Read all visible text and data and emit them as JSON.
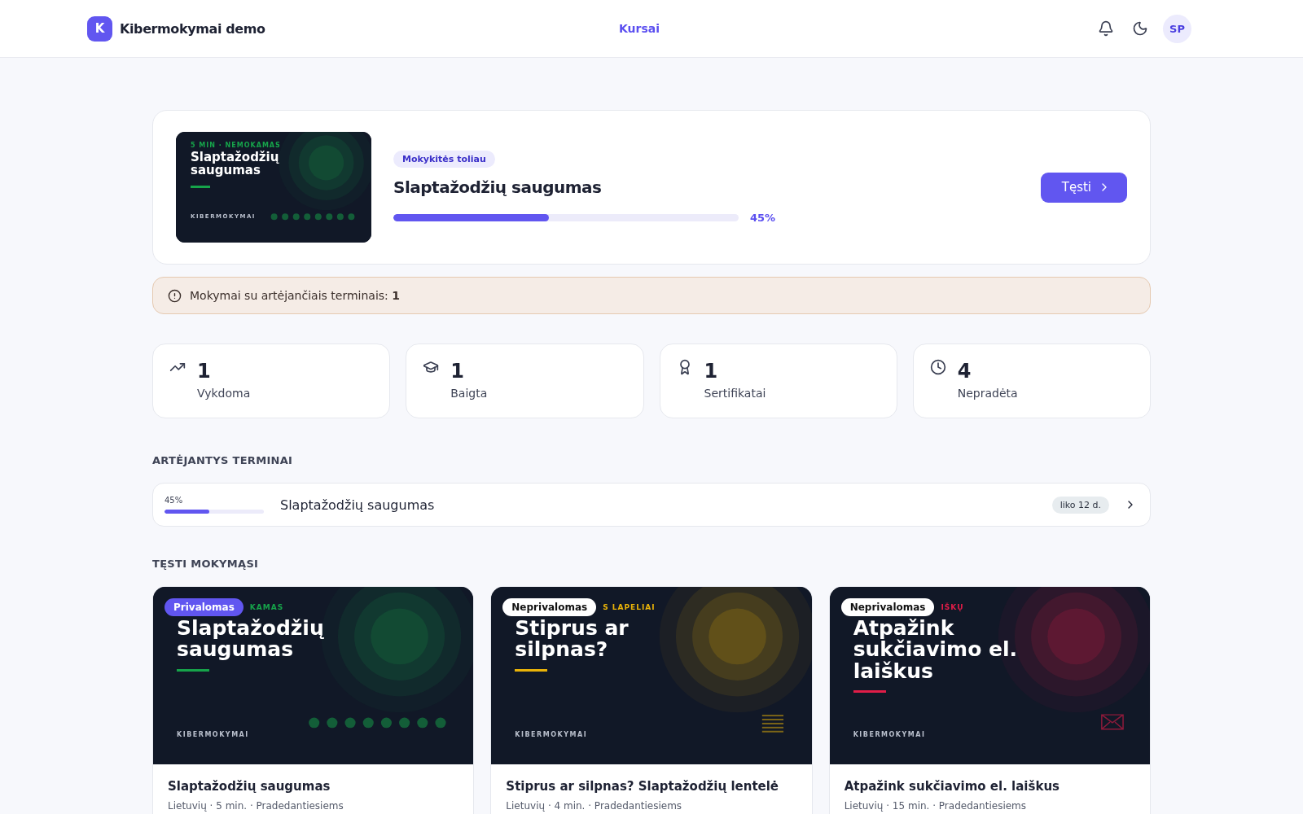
{
  "header": {
    "logo_letter": "K",
    "brand": "Kibermokymai demo",
    "nav": [
      {
        "label": "Kursai",
        "selected": true
      }
    ],
    "avatar": "SP"
  },
  "hero": {
    "cover": {
      "eyebrow": "5 MIN · NEMOKAMAS",
      "title": "Slaptažodžių saugumas",
      "brand": "KIBERMOKYMAI",
      "color": "#16a34a"
    },
    "badge": "Mokykitės toliau",
    "title": "Slaptažodžių saugumas",
    "level": 0.45,
    "percent": "45%",
    "button": "Tęsti"
  },
  "alert": {
    "text": "Mokymai su artėjančiais terminais: **1**"
  },
  "stats": [
    {
      "kind": "trend",
      "value": "1",
      "label": "Vykdoma"
    },
    {
      "kind": "cap",
      "value": "1",
      "label": "Baigta"
    },
    {
      "kind": "award",
      "value": "1",
      "label": "Sertifikatai"
    },
    {
      "kind": "clock",
      "value": "4",
      "label": "Nepradėta"
    }
  ],
  "deadlines": {
    "heading": "ARTĖJANTYS TERMINAI",
    "items": [
      {
        "percent": "45%",
        "level": 0.45,
        "title": "Slaptažodžių saugumas",
        "remaining": "liko 12 d."
      }
    ]
  },
  "continue": {
    "heading": "TĘSTI MOKYMĄSI",
    "courses": [
      {
        "badge": "Privalomas",
        "kind": "required",
        "cover": {
          "eyebrow": "KAMAS",
          "title": "Slaptažodžių saugumas",
          "brand": "KIBERMOKYMAI",
          "color": "#16a34a"
        },
        "title": "Slaptažodžių saugumas",
        "meta": "Lietuvių · 5 min. · Pradedantiesiems"
      },
      {
        "badge": "Neprivalomas",
        "kind": "optional",
        "cover": {
          "eyebrow": "S LAPELIAI",
          "title": "Stiprus ar silpnas?",
          "brand": "KIBERMOKYMAI",
          "color": "#eab308"
        },
        "title": "Stiprus ar silpnas? Slaptažodžių lentelė",
        "meta": "Lietuvių · 4 min. · Pradedantiesiems"
      },
      {
        "badge": "Neprivalomas",
        "kind": "optional",
        "cover": {
          "eyebrow": "IŠKŲ",
          "title": "Atpažink sukčiavimo el. laiškus",
          "brand": "KIBERMOKYMAI",
          "color": "#e11d48"
        },
        "title": "Atpažink sukčiavimo el. laiškus",
        "meta": "Lietuvių · 15 min. · Pradedantiesiems"
      }
    ]
  }
}
